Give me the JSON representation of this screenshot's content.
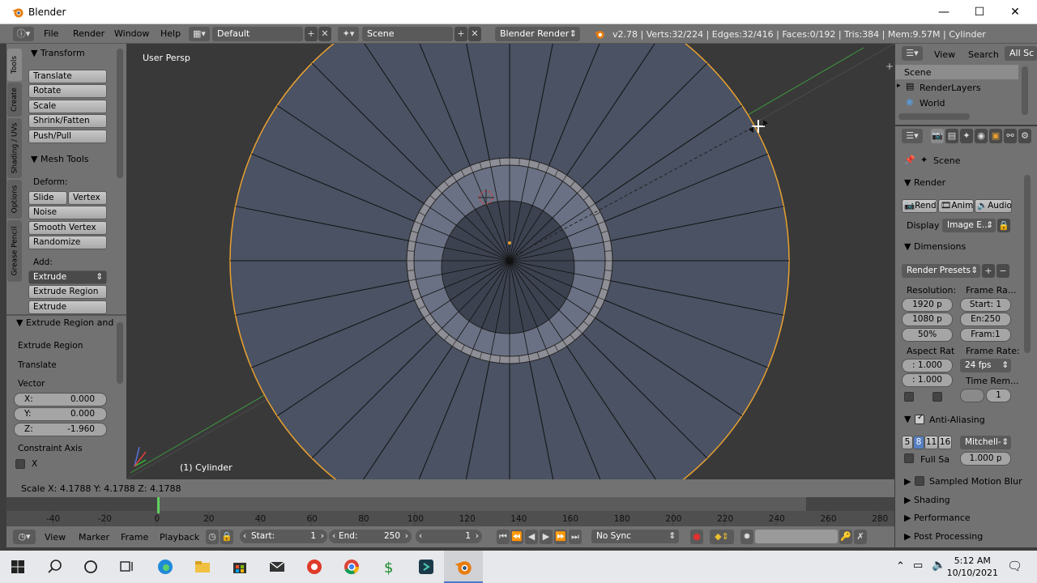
{
  "window": {
    "title": "Blender"
  },
  "topbar": {
    "menus": [
      "File",
      "Render",
      "Window",
      "Help"
    ],
    "layout": "Default",
    "scene": "Scene",
    "engine": "Blender Render",
    "stats": "v2.78 | Verts:32/224 | Edges:32/416 | Faces:0/192 | Tris:384 | Mem:9.57M | Cylinder"
  },
  "tools": {
    "tabs": [
      "Tools",
      "Create",
      "Shading / UVs",
      "Options",
      "Grease Pencil"
    ],
    "transform_header": "Transform",
    "transform_buttons": [
      "Translate",
      "Rotate",
      "Scale",
      "Shrink/Fatten",
      "Push/Pull"
    ],
    "meshtools_header": "Mesh Tools",
    "deform_label": "Deform:",
    "slide_edge": "Slide Ed",
    "vertex": "Vertex",
    "deform_buttons": [
      "Noise",
      "Smooth Vertex",
      "Randomize"
    ],
    "add_label": "Add:",
    "extrude": "Extrude",
    "add_buttons": [
      "Extrude Region",
      "Extrude Individual"
    ]
  },
  "operator": {
    "header": "Extrude Region and",
    "line1": "Extrude Region",
    "line2": "Translate",
    "vector_label": "Vector",
    "x_label": "X:",
    "x_value": "0.000",
    "y_label": "Y:",
    "y_value": "0.000",
    "z_label": "Z:",
    "z_value": "-1.960",
    "constraint_label": "Constraint Axis",
    "constraint_x": "X"
  },
  "viewport": {
    "view_label": "User Persp",
    "object_label": "(1) Cylinder",
    "scale_info": "Scale X: 4.1788   Y: 4.1788   Z: 4.1788"
  },
  "timeline": {
    "ticks": [
      "-40",
      "-20",
      "0",
      "20",
      "40",
      "60",
      "80",
      "100",
      "120",
      "140",
      "160",
      "180",
      "200",
      "220",
      "240",
      "260",
      "280"
    ],
    "current_frame_marker": "1",
    "menus": [
      "View",
      "Marker",
      "Frame",
      "Playback"
    ],
    "start_label": "Start:",
    "start_value": "1",
    "end_label": "End:",
    "end_value": "250",
    "current": "1",
    "sync": "No Sync"
  },
  "outliner": {
    "view": "View",
    "search": "Search",
    "filter": "All Sc",
    "items": [
      "Scene",
      "RenderLayers",
      "World"
    ]
  },
  "properties": {
    "context": "Scene",
    "render_header": "Render",
    "render_btn": "Rend",
    "anim_btn": "Anim",
    "audio_btn": "Audio",
    "display_label": "Display",
    "display_value": "Image E...",
    "dimensions_header": "Dimensions",
    "render_presets": "Render Presets",
    "resolution_label": "Resolution:",
    "frame_range_label": "Frame Ra...",
    "res_x": "1920 p",
    "res_y": "1080 p",
    "res_pct": "50%",
    "start": "Start: 1",
    "end": "En:250",
    "frame_step": "Fram:1",
    "aspect_label": "Aspect Rat",
    "frame_rate_label": "Frame Rate:",
    "aspect_x": ": 1.000",
    "aspect_y": ": 1.000",
    "fps": "24 fps",
    "time_remap_label": "Time Rem...",
    "time_remap_value": "1",
    "aa_header": "Anti-Aliasing",
    "aa_samples": [
      "5",
      "8",
      "11",
      "16"
    ],
    "aa_filter": "Mitchell-",
    "full_sample": "Full Sa",
    "filter_size": "1.000 p",
    "motion_blur": "Sampled Motion Blur",
    "shading": "Shading",
    "performance": "Performance",
    "post_processing": "Post Processing"
  },
  "taskbar": {
    "time": "5:12 AM",
    "date": "10/10/2021"
  },
  "colors": {
    "accent_orange": "#e8a030",
    "mesh_fill": "#4a5263",
    "selected_blue": "#5680c2"
  }
}
